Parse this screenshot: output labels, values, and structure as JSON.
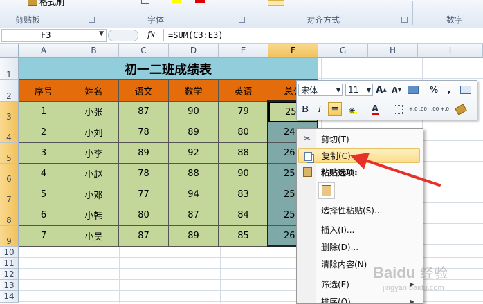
{
  "ribbon": {
    "clipboard_label": "剪贴板",
    "format_painter": "格式刷",
    "font_label": "字体",
    "align_label": "对齐方式",
    "number_label": "数字"
  },
  "formula_bar": {
    "name_box": "F3",
    "fx": "fx",
    "formula": "=SUM(C3:E3)"
  },
  "columns": [
    "A",
    "B",
    "C",
    "D",
    "E",
    "F",
    "G",
    "H",
    "I"
  ],
  "rows": [
    "1",
    "2",
    "3",
    "4",
    "5",
    "6",
    "7",
    "8",
    "9",
    "10",
    "11",
    "12",
    "13",
    "14"
  ],
  "sheet": {
    "title": "初一二班成绩表",
    "headers": [
      "序号",
      "姓名",
      "语文",
      "数学",
      "英语",
      "总分"
    ],
    "data": [
      [
        "1",
        "小张",
        "87",
        "90",
        "79",
        "25"
      ],
      [
        "2",
        "小刘",
        "78",
        "89",
        "80",
        "24"
      ],
      [
        "3",
        "小李",
        "89",
        "92",
        "88",
        "26"
      ],
      [
        "4",
        "小赵",
        "78",
        "88",
        "90",
        "25"
      ],
      [
        "5",
        "小邓",
        "77",
        "94",
        "83",
        "25"
      ],
      [
        "6",
        "小韩",
        "80",
        "87",
        "84",
        "25"
      ],
      [
        "7",
        "小吴",
        "87",
        "89",
        "85",
        "26"
      ]
    ]
  },
  "mini_toolbar": {
    "font_name": "宋体",
    "font_size": "11",
    "bold": "B",
    "italic": "I",
    "percent": "%",
    "comma": ",",
    "inc_decimal": "+.0 .00",
    "dec_decimal": ".00 +.0"
  },
  "context_menu": {
    "cut": "剪切(T)",
    "copy": "复制(C)",
    "paste_options": "粘贴选项:",
    "paste_special": "选择性粘贴(S)...",
    "insert": "插入(I)...",
    "delete": "删除(D)...",
    "clear": "清除内容(N)",
    "filter": "筛选(E)",
    "sort": "排序(O)"
  },
  "colors": {
    "title_fill": "#92cddc",
    "header_fill": "#e46c0a",
    "data_fill": "#c4d79b",
    "selected_fill": "#7fa9a8",
    "annotation_arrow": "#e8302a"
  },
  "watermark": "Baidu 经验 jingyan.baidu.com"
}
